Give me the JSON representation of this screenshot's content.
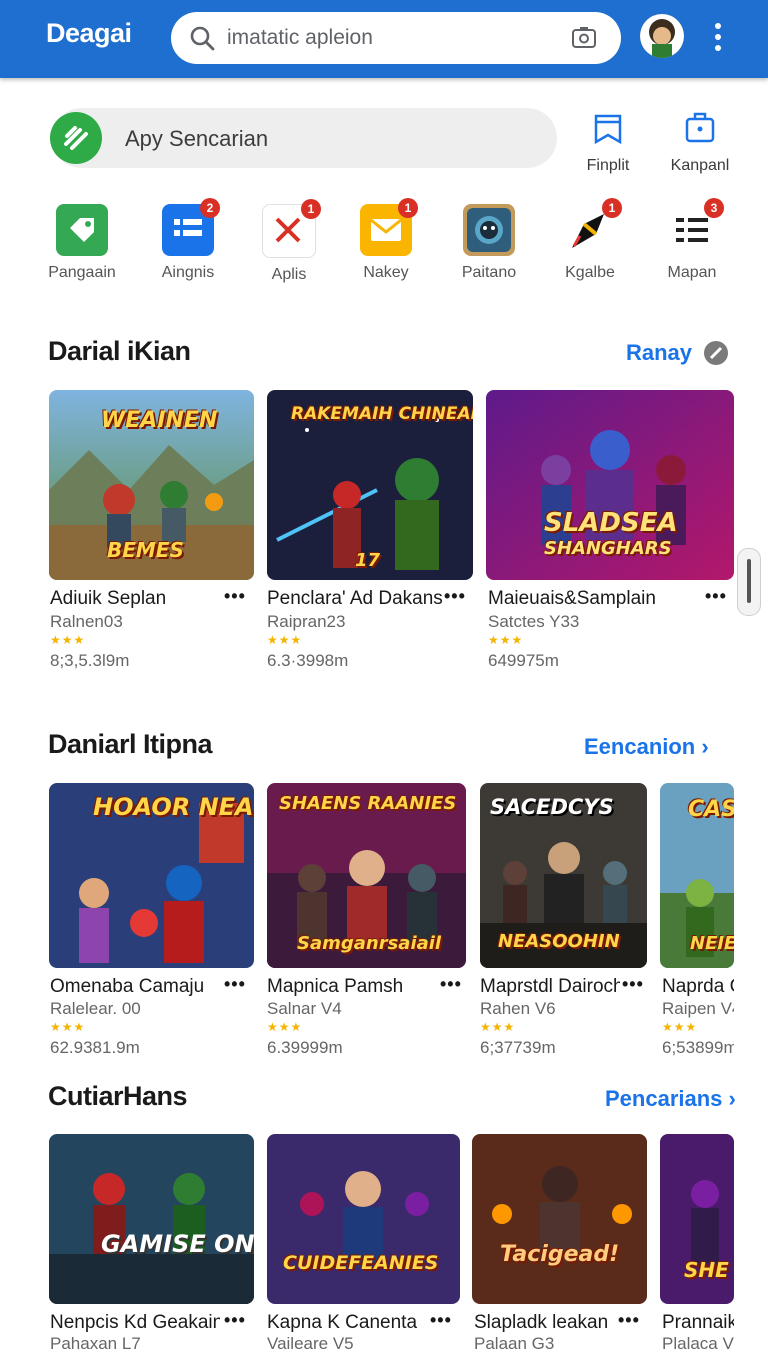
{
  "header": {
    "brand": "Deagai",
    "search_placeholder": "imatatic apleion",
    "accent": "#1e6fd0"
  },
  "subbar": {
    "pill_text": "Apy Sencarian",
    "quick_actions": [
      {
        "label": "Finplit",
        "icon": "bookmark-icon"
      },
      {
        "label": "Kanpanl",
        "icon": "briefcase-icon"
      }
    ]
  },
  "categories": [
    {
      "label": "Pangaain",
      "icon": "tag-icon",
      "badge": ""
    },
    {
      "label": "Aingnis",
      "icon": "list-icon",
      "badge": "2"
    },
    {
      "label": "Aplis",
      "icon": "close-icon",
      "badge": "1"
    },
    {
      "label": "Nakey",
      "icon": "mail-icon",
      "badge": "1"
    },
    {
      "label": "Paitano",
      "icon": "game-icon",
      "badge": ""
    },
    {
      "label": "Kgalbe",
      "icon": "rocket-icon",
      "badge": "1"
    },
    {
      "label": "Mapan",
      "icon": "menu-icon",
      "badge": "3"
    }
  ],
  "sections": [
    {
      "title": "Darial iKian",
      "link": "Ranay",
      "cards": [
        {
          "art": "WEAINEN",
          "art2": "BEMES",
          "title": "Adiuik Seplan",
          "sub": "Ralnen03",
          "stars": "★★★",
          "size": "8;3,5.3l9m"
        },
        {
          "art": "RAKEMAIH CHINEAI",
          "art2": "17",
          "title": "Penclara' Ad Dakans",
          "sub": "Raipran23",
          "stars": "★★★",
          "size": "6.3·3998m"
        },
        {
          "art": "SLADSEA",
          "art2": "SHANGHARS",
          "title": "Maieuais&Samplain",
          "sub": "Satctes Y33",
          "stars": "★★★",
          "size": "649975m"
        }
      ]
    },
    {
      "title": "Daniarl Itipna",
      "link": "Eencanion",
      "cards": [
        {
          "art": "HOAOR NEASIN",
          "art2": "",
          "title": "Omenaba Camaju",
          "sub": "Ralelear. 00",
          "stars": "★★★",
          "size": "62.9381.9m"
        },
        {
          "art": "SHAENS RAANIES",
          "art2": "Samganrsaiail",
          "title": "Mapnica Pamsh",
          "sub": "Salnar V4",
          "stars": "★★★",
          "size": "6.39999m"
        },
        {
          "art": "SACEDCYS",
          "art2": "NEASOOHIN",
          "title": "Maprstdl Dairoch",
          "sub": "Rahen V6",
          "stars": "★★★",
          "size": "6;37739m"
        },
        {
          "art": "CAS",
          "art2": "NEIE",
          "title": "Naprda C",
          "sub": "Raipen V4",
          "stars": "★★★",
          "size": "6;53899m"
        }
      ]
    },
    {
      "title": "CutiarHans",
      "link": "Pencarians",
      "cards": [
        {
          "art": "GAMISE ONEAAIN",
          "art2": "",
          "title": "Nenpcis Kd Geakain",
          "sub": "Pahaxan L7",
          "stars": "★★★",
          "size": ""
        },
        {
          "art": "CUIDEFEANIES",
          "art2": "",
          "title": "Kapna K Canenta",
          "sub": "Vaileare V5",
          "stars": "★★★",
          "size": ""
        },
        {
          "art": "Tacigead!",
          "art2": "",
          "title": "Slapladk leakan",
          "sub": "Palaan G3",
          "stars": "★★★",
          "size": ""
        },
        {
          "art": "SHE",
          "art2": "",
          "title": "Prannaik",
          "sub": "Plalaca V4",
          "stars": "★★★",
          "size": ""
        }
      ]
    }
  ]
}
